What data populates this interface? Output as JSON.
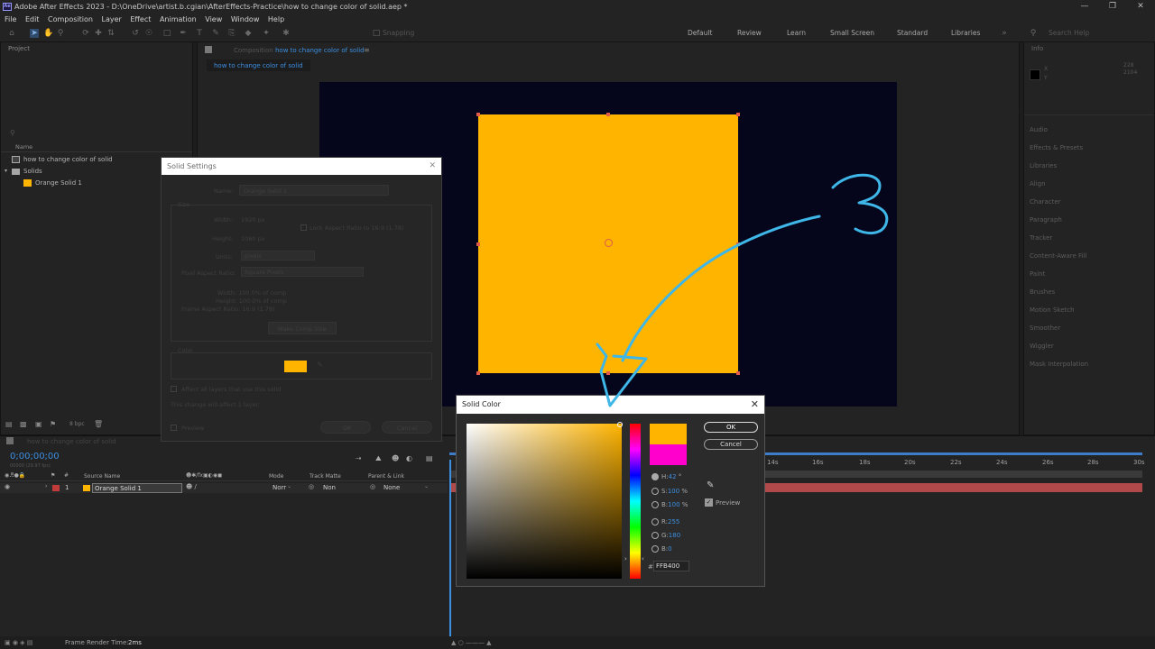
{
  "app": {
    "title": "Adobe After Effects 2023 - D:\\OneDrive\\artist.b.cgian\\AfterEffects-Practice\\how to change color of solid.aep *",
    "logo": "Ae"
  },
  "menu": [
    "File",
    "Edit",
    "Composition",
    "Layer",
    "Effect",
    "Animation",
    "View",
    "Window",
    "Help"
  ],
  "workspaces": [
    "Default",
    "Review",
    "Learn",
    "Small Screen",
    "Standard",
    "Libraries"
  ],
  "search_placeholder": "Search Help",
  "toolbar": {
    "snapping": "Snapping"
  },
  "project": {
    "panel_label": "Project",
    "column_name": "Name",
    "items": [
      {
        "name": "how to change color of solid",
        "type": "comp"
      },
      {
        "name": "Solids",
        "type": "folder"
      },
      {
        "name": "Orange Solid 1",
        "type": "solid",
        "color": "#ffb400"
      }
    ],
    "bpc": "8 bpc"
  },
  "composition": {
    "tab_prefix": "Composition",
    "tab_name": "how to change color of solid",
    "breadcrumb": "how to change color of solid",
    "background_color": "#05061b",
    "solid_color": "#ffb400"
  },
  "right_panel": {
    "info_label": "Info",
    "coords": [
      "X",
      "Y",
      "228",
      "2104"
    ],
    "items": [
      "Audio",
      "Effects & Presets",
      "Libraries",
      "Align",
      "Character",
      "Paragraph",
      "Tracker",
      "Content-Aware Fill",
      "Paint",
      "Brushes",
      "Motion Sketch",
      "Smoother",
      "Wiggler",
      "Mask Interpolation"
    ]
  },
  "solid_settings": {
    "title": "Solid Settings",
    "name_label": "Name:",
    "name_value": "Orange Solid 1",
    "size_label": "Size",
    "width_label": "Width:",
    "width_value": "1920 px",
    "height_label": "Height:",
    "height_value": "1080 px",
    "lock_label": "Lock Aspect Ratio to 16:9 (1.78)",
    "units_label": "Units:",
    "units_value": "pixels",
    "par_label": "Pixel Aspect Ratio:",
    "par_value": "Square Pixels",
    "width_pct": "Width: 100.0% of comp",
    "height_pct": "Height: 100.0% of comp",
    "frame_ar": "Frame Aspect Ratio: 16:9 (1.78)",
    "make_comp_size": "Make Comp Size",
    "color_label": "Color",
    "affect_label": "Affect all layers that use this solid",
    "change_note": "This change will affect 1 layer.",
    "preview_label": "Preview",
    "ok": "OK",
    "cancel": "Cancel"
  },
  "timeline": {
    "tab_name": "how to change color of solid",
    "timecode": "0;00;00;00",
    "fps": "00000 (29.97 fps)",
    "columns": {
      "source": "Source Name",
      "mode": "Mode",
      "track_matte": "Track Matte",
      "parent": "Parent & Link",
      "hash": "#"
    },
    "layer": {
      "index": "1",
      "name": "Orange Solid 1",
      "mode": "Norr",
      "matte": "Non",
      "parent": "None",
      "label_color": "#c23b3b"
    },
    "ruler": [
      "14s",
      "16s",
      "18s",
      "20s",
      "22s",
      "24s",
      "26s",
      "28s",
      "30s"
    ]
  },
  "status": {
    "label": "Frame Render Time:",
    "value": "2ms"
  },
  "solid_color_dialog": {
    "title": "Solid Color",
    "ok": "OK",
    "cancel": "Cancel",
    "preview_label": "Preview",
    "new_color": "#ffb400",
    "old_color": "#ff00cc",
    "fields": [
      {
        "label": "H:",
        "value": "42",
        "unit": "°"
      },
      {
        "label": "S:",
        "value": "100",
        "unit": "%"
      },
      {
        "label": "B:",
        "value": "100",
        "unit": "%"
      },
      {
        "label": "R:",
        "value": "255",
        "unit": ""
      },
      {
        "label": "G:",
        "value": "180",
        "unit": ""
      },
      {
        "label": "B:",
        "value": "0",
        "unit": ""
      }
    ],
    "hex": "FFB400",
    "hash": "#"
  },
  "annotation": {
    "text": "3",
    "color": "#3fb6e8"
  }
}
